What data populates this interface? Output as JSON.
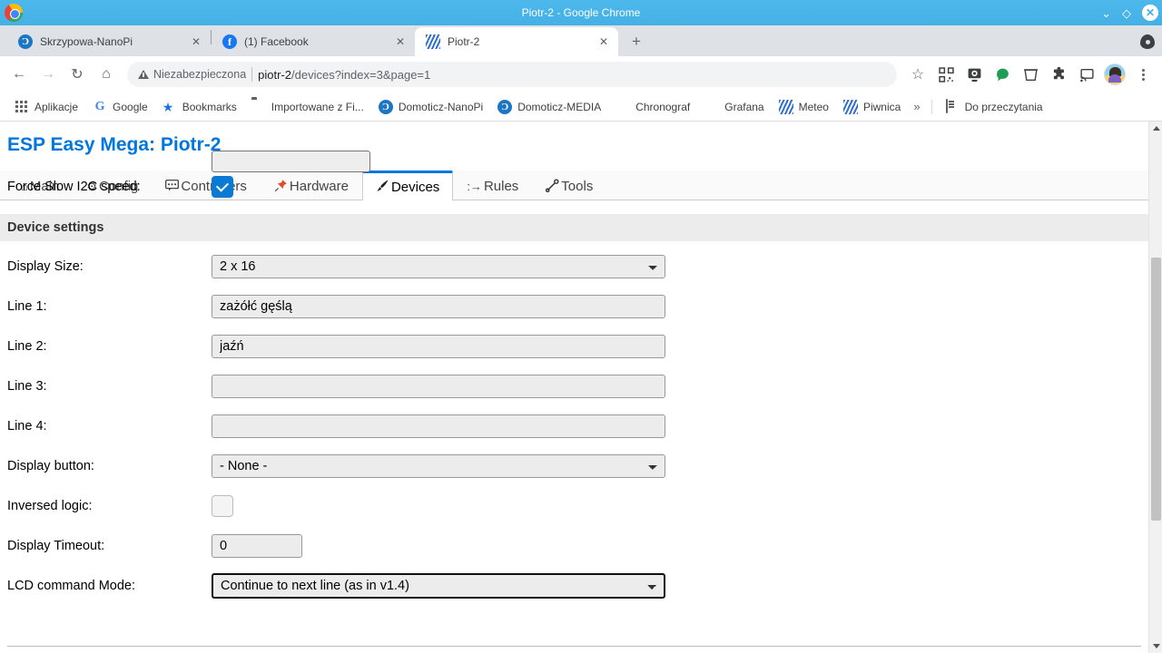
{
  "window": {
    "title": "Piotr-2 - Google Chrome",
    "minimize_label": "⌄",
    "maximize_label": "◇",
    "close_label": "✕"
  },
  "tabs": [
    {
      "title": "Skrzypowa-NanoPi",
      "favicon": "domoticz-icon",
      "favicon_letter": "Ɔ",
      "close_label": "✕",
      "active": false
    },
    {
      "title": "(1) Facebook",
      "favicon": "facebook-icon",
      "favicon_letter": "f",
      "close_label": "✕",
      "active": false
    },
    {
      "title": "Piotr-2",
      "favicon": "esp-easy-icon",
      "favicon_letter": "",
      "close_label": "✕",
      "active": true
    }
  ],
  "new_tab_label": "+",
  "toolbar": {
    "back_label": "←",
    "forward_label": "→",
    "reload_label": "↻",
    "home_label": "⌂",
    "security_text": "Niezabezpieczona",
    "url_host": "piotr-2",
    "url_path": "/devices?index=3&page=1",
    "full_url": "piotr-2/devices?index=3&page=1",
    "bookmark_star_label": "☆",
    "icons": [
      "qr-code-icon",
      "webcam-icon",
      "green-dot-icon",
      "trash-icon",
      "extensions-puzzle-icon",
      "cast-icon"
    ],
    "menu_label": "⋮"
  },
  "bookmarks": {
    "items": [
      {
        "label": "Aplikacje",
        "icon": "apps-grid-icon"
      },
      {
        "label": "Google",
        "icon": "google-g-icon"
      },
      {
        "label": "Bookmarks",
        "icon": "star-icon"
      },
      {
        "label": "Importowane z Fi...",
        "icon": "folder-icon"
      },
      {
        "label": "Domoticz-NanoPi",
        "icon": "domoticz-icon"
      },
      {
        "label": "Domoticz-MEDIA",
        "icon": "domoticz-icon"
      },
      {
        "label": "Chronograf",
        "icon": "chronograf-icon"
      },
      {
        "label": "Grafana",
        "icon": "grafana-icon"
      },
      {
        "label": "Meteo",
        "icon": "esp-easy-icon"
      },
      {
        "label": "Piwnica",
        "icon": "esp-easy-icon"
      }
    ],
    "overflow_label": "»",
    "reading_list_label": "Do przeczytania"
  },
  "page": {
    "title": "ESP Easy Mega: Piotr-2",
    "nav": [
      {
        "label": "Main",
        "icon": "⌂",
        "active": false
      },
      {
        "label": "Config",
        "icon": "⚙",
        "active": false
      },
      {
        "label": "Controllers",
        "icon": "Ὂc",
        "active": false
      },
      {
        "label": "Hardware",
        "icon": "📌",
        "active": false
      },
      {
        "label": "Devices",
        "icon": "✎",
        "active": true
      },
      {
        "label": "Rules",
        "icon": ":→",
        "active": false
      },
      {
        "label": "Tools",
        "icon": "🔧",
        "active": false
      }
    ],
    "form": {
      "force_slow_i2c_label": "Force Slow I2C speed:",
      "force_slow_i2c_checked": true,
      "section_header": "Device settings",
      "display_size_label": "Display Size:",
      "display_size_value": "2 x 16",
      "line1_label": "Line 1:",
      "line1_value": "zażółć gęślą",
      "line2_label": "Line 2:",
      "line2_value": "jaźń",
      "line3_label": "Line 3:",
      "line3_value": "",
      "line4_label": "Line 4:",
      "line4_value": "",
      "display_button_label": "Display button:",
      "display_button_value": "- None -",
      "inversed_logic_label": "Inversed logic:",
      "inversed_logic_checked": false,
      "display_timeout_label": "Display Timeout:",
      "display_timeout_value": "0",
      "lcd_command_mode_label": "LCD command Mode:",
      "lcd_command_mode_value": "Continue to next line (as in v1.4)"
    }
  },
  "colors": {
    "titlebar": "#45b0e6",
    "accent_link": "#0077dd",
    "checkbox_checked": "#0b7ad5",
    "tabstrip": "#dee1e6",
    "field_bg": "#ececec"
  }
}
